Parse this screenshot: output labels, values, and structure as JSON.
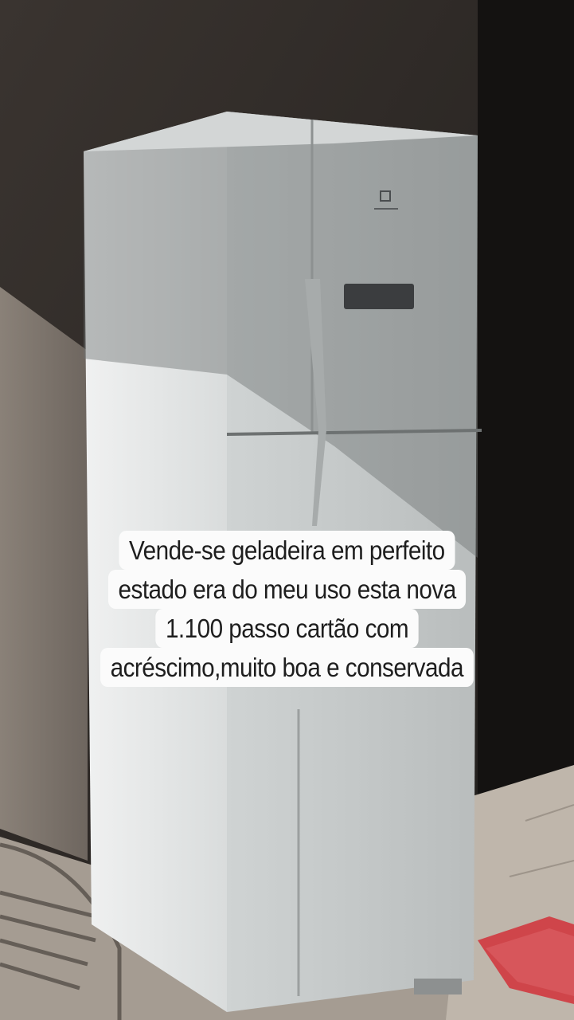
{
  "caption": {
    "lines": [
      "Vende-se geladeira em perfeito",
      "estado era do meu uso esta nova",
      "1.100 passo cartão com",
      "acréscimo,muito boa e conservada"
    ]
  },
  "appliance": {
    "description_icon": "electrolux-logo-icon"
  },
  "colors": {
    "caption_bg": "#fbfbfb",
    "caption_text": "#1e1e1e",
    "wall_dark": "#2a2624",
    "fridge_white": "#e6e8e8",
    "rug": "#d0484c"
  }
}
